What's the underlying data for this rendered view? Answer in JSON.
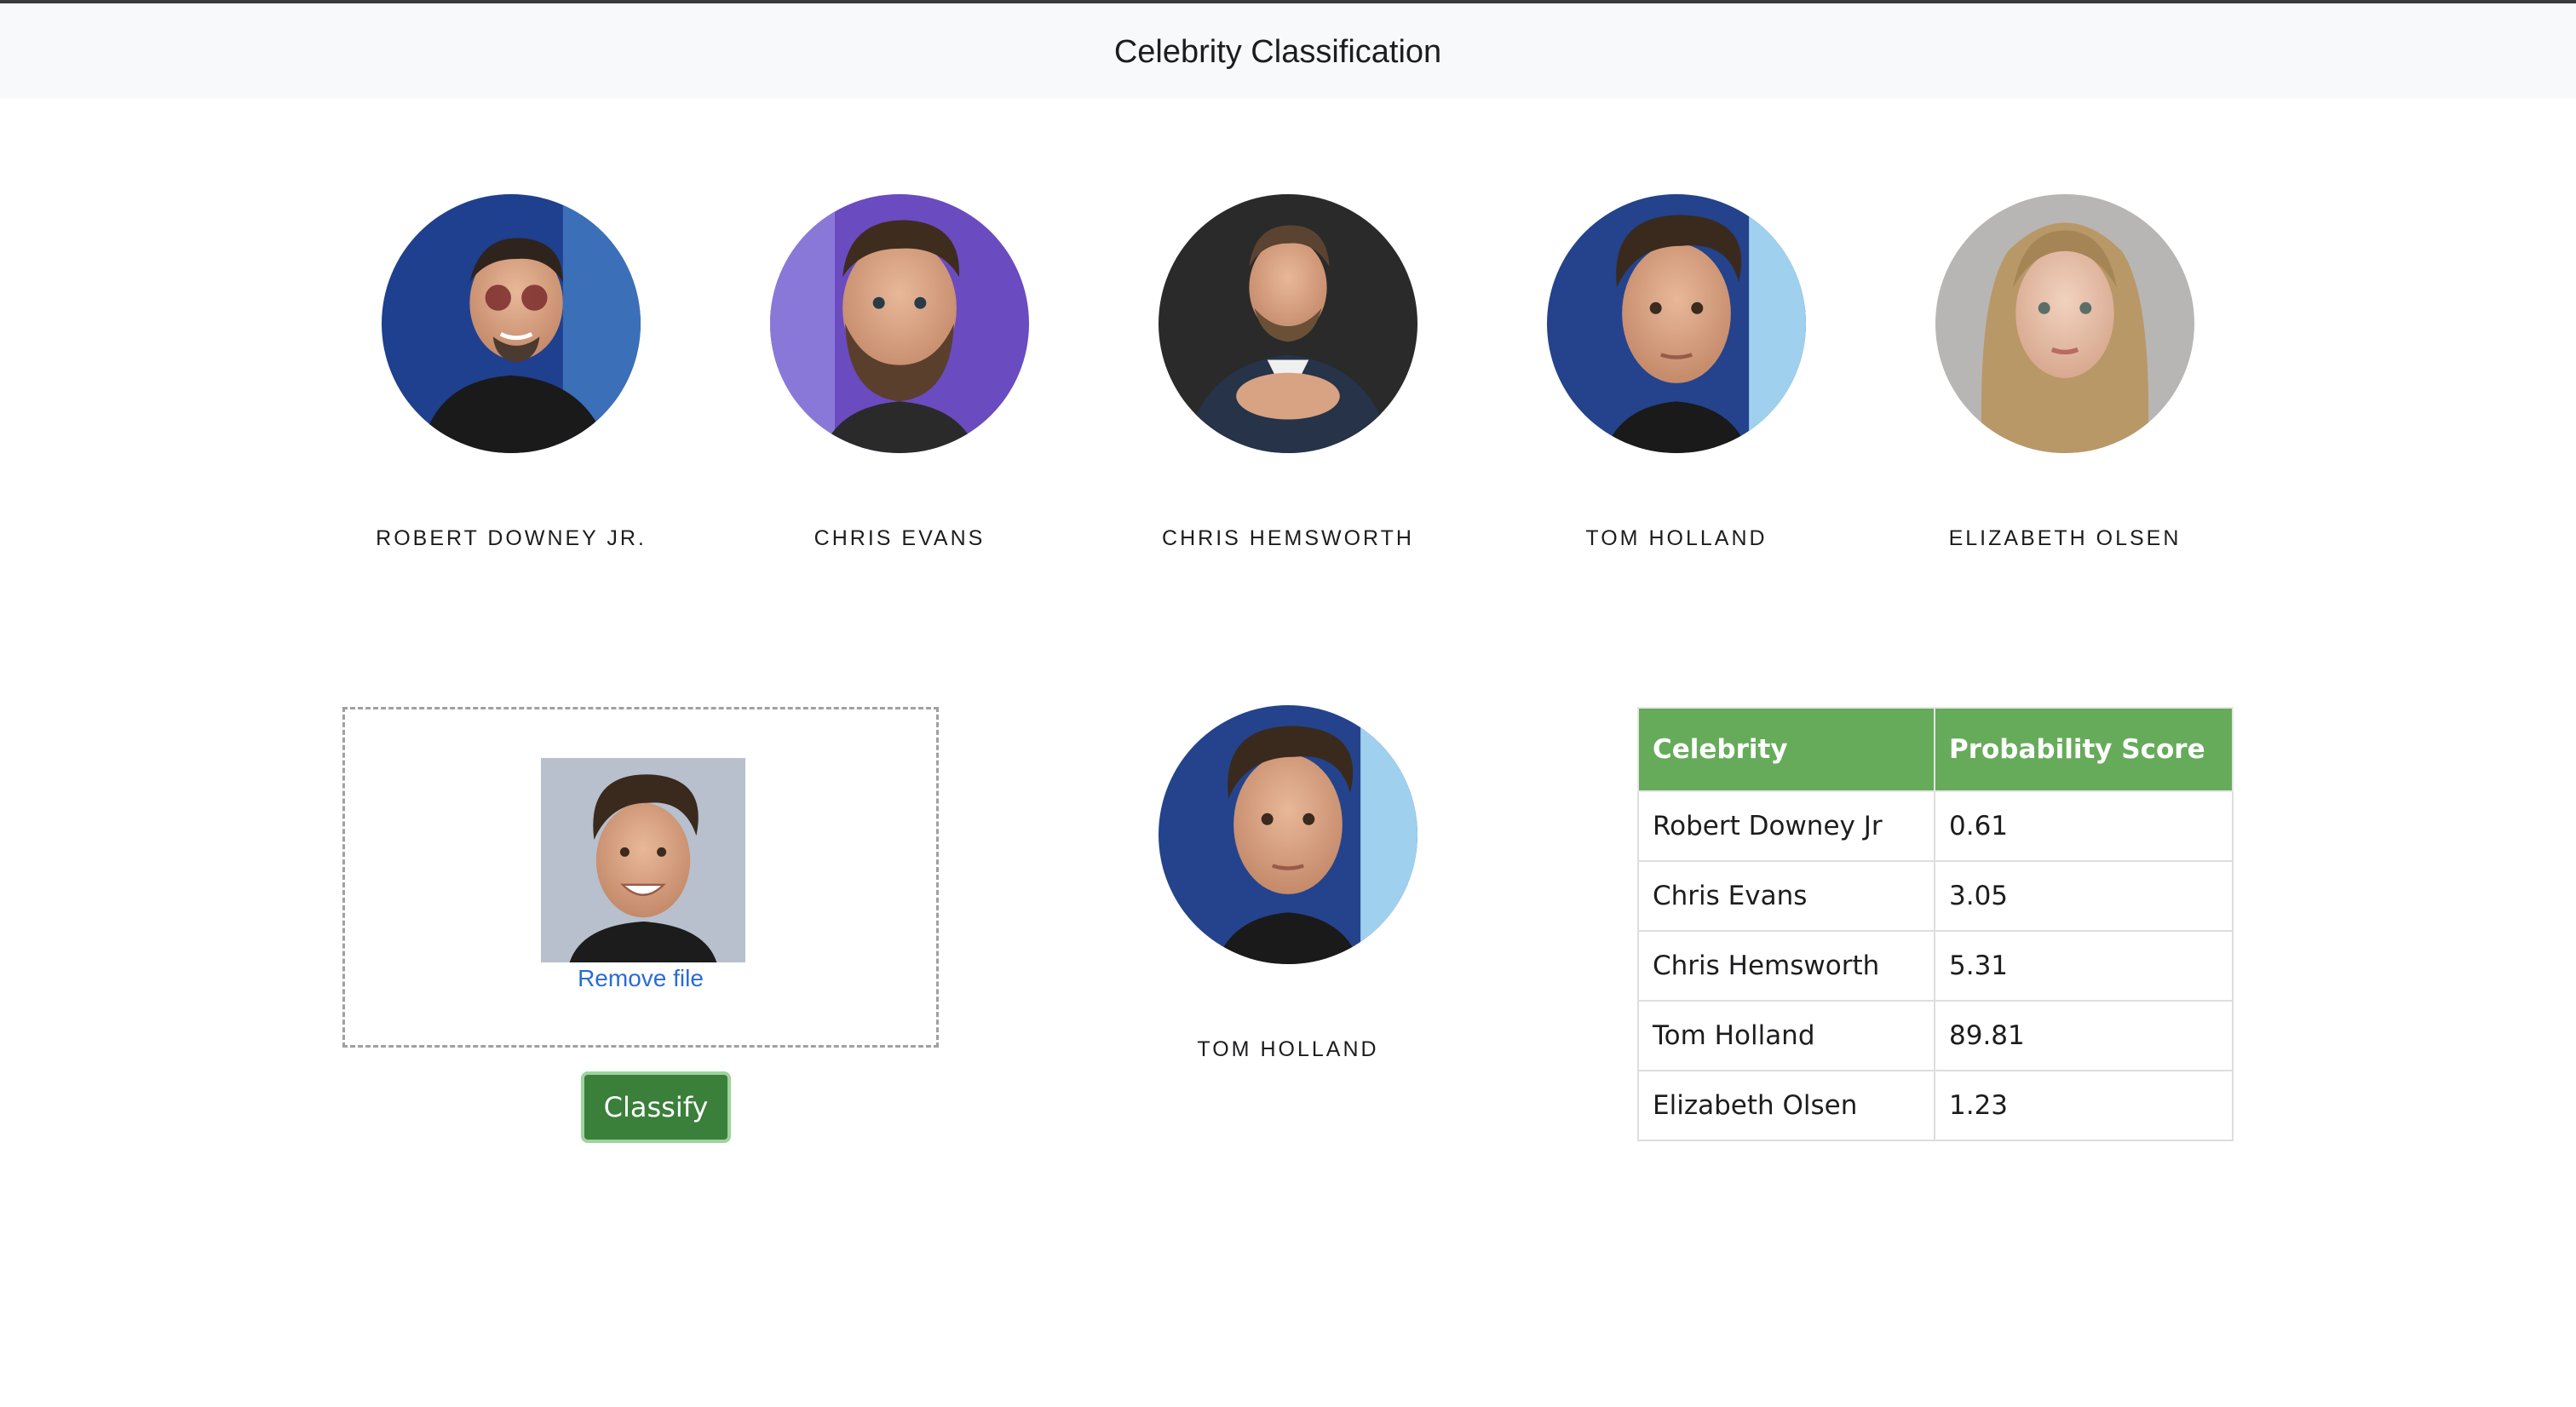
{
  "header": {
    "title": "Celebrity Classification"
  },
  "celebrities": [
    {
      "name": "ROBERT DOWNEY JR."
    },
    {
      "name": "CHRIS EVANS"
    },
    {
      "name": "CHRIS HEMSWORTH"
    },
    {
      "name": "TOM HOLLAND"
    },
    {
      "name": "ELIZABETH OLSEN"
    }
  ],
  "upload": {
    "remove_label": "Remove file",
    "classify_label": "Classify"
  },
  "result": {
    "name": "TOM HOLLAND"
  },
  "table": {
    "headers": [
      "Celebrity",
      "Probability Score"
    ],
    "rows": [
      [
        "Robert Downey Jr",
        "0.61"
      ],
      [
        "Chris Evans",
        "3.05"
      ],
      [
        "Chris Hemsworth",
        "5.31"
      ],
      [
        "Tom Holland",
        "89.81"
      ],
      [
        "Elizabeth Olsen",
        "1.23"
      ]
    ]
  },
  "colors": {
    "header_bg": "#f8f9fa",
    "table_header": "#66ab5a",
    "button": "#3a7f3a",
    "link": "#2a6bd6"
  }
}
